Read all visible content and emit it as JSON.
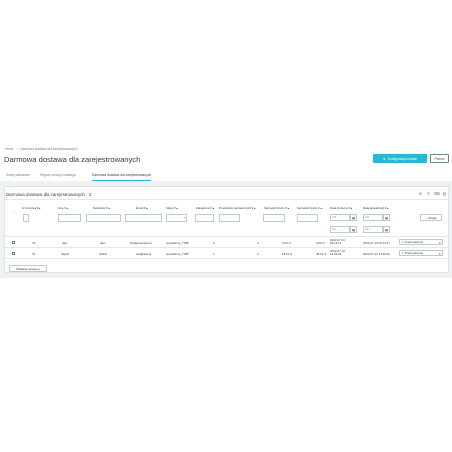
{
  "breadcrumb": [
    "Home",
    "Darmowa dostawa dla zarejestrowanych"
  ],
  "page_title": "Darmowa dostawa dla zarejestrowanych",
  "toolbar": {
    "config_label": "Konfiguracja modułu",
    "help_label": "Pomoc",
    "config_icon": "gear-icon"
  },
  "tabs": [
    {
      "label": "Koszy zakazane"
    },
    {
      "label": "Reguły rozwoju katalogu"
    },
    {
      "label": "Darmowa dostawa dla zarejestrowanych"
    }
  ],
  "panel": {
    "title": "Darmowa dostawa dla zarejestrowanych",
    "count": "2"
  },
  "columns": [
    "Id Cennika ▾ ▴",
    "Imię ▾ ▴",
    "Nazwisko ▾ ▴",
    "Email ▾ ▴",
    "Sklep ▾ ▴",
    "Zakupiono ▾ ▴",
    "Produktów zamówionych ▾ ▴",
    "Sprzedaż brutto ▾ ▴",
    "Sprzedaż brutto ▾ ▴",
    "Data złożenia ▾ ▴",
    "Data aktualizacji ▾ ▴"
  ],
  "filters": {
    "dash": "--",
    "date_from": "Od",
    "date_to": "Do",
    "search_label": "Szukaj",
    "shop_select": "▾"
  },
  "rows": [
    {
      "id": "74",
      "first": "dam",
      "last": "dam",
      "email": "info@example.pl",
      "shop": "prestashop_7788",
      "bought": "0",
      "products": "0",
      "gross": "0,00 zł",
      "gross2": "0,00 zł",
      "created": "2022-07-14 06:13:17",
      "updated": "2022-07-14 06:13:17",
      "action": "Zmiana kliencie"
    },
    {
      "id": "75",
      "first": "fdgsdf",
      "last": "sdfsdf",
      "email": "asd@asd.pl",
      "shop": "prestashop_7788",
      "bought": "1",
      "products": "3",
      "gross": "28,51 zł",
      "gross2": "28,51 zł",
      "created": "2022-07-14 14:36:22",
      "updated": "2022-07-14 14:36:22",
      "action": "Zmiana kliencie"
    }
  ],
  "bulk_label": "Działania masowe ▴"
}
